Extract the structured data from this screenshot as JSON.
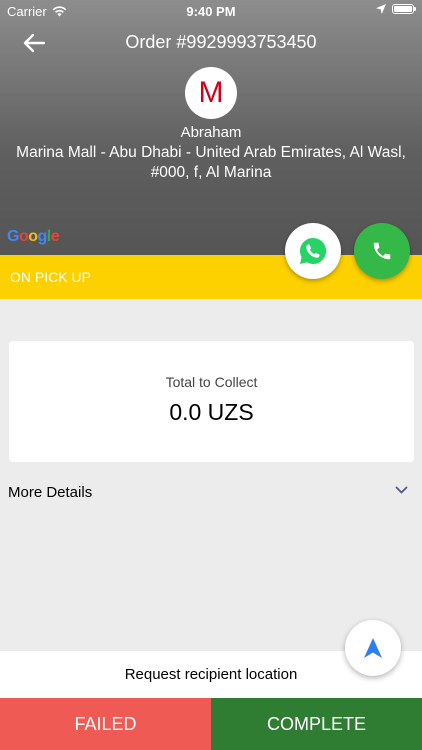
{
  "status_bar": {
    "carrier": "Carrier",
    "time": "9:40 PM",
    "battery_level": 1.0
  },
  "header": {
    "title": "Order #9929993753450",
    "avatar_letter": "M",
    "customer_name": "Abraham",
    "address": "Marina Mall - Abu Dhabi - United Arab Emirates, Al Wasl, #000, f, Al Marina",
    "map_brand": "Google"
  },
  "status": {
    "label": "ON PICK UP",
    "color": "#fdd000"
  },
  "collect": {
    "label": "Total to Collect",
    "amount": "0.0 UZS"
  },
  "more_details": {
    "label": "More Details"
  },
  "request_location": {
    "label": "Request recipient location"
  },
  "actions": {
    "failed_label": "FAILED",
    "complete_label": "COMPLETE"
  },
  "colors": {
    "failed": "#ef5a54",
    "complete": "#2e7d32",
    "call": "#34b847",
    "whatsapp": "#25d366",
    "avatar_letter": "#d0021b",
    "nav_arrow": "#2f80ed"
  },
  "icons": {
    "back": "arrow-left-icon",
    "whatsapp": "whatsapp-icon",
    "call": "phone-icon",
    "expand": "chevron-down-icon",
    "navigate": "navigation-arrow-icon"
  }
}
